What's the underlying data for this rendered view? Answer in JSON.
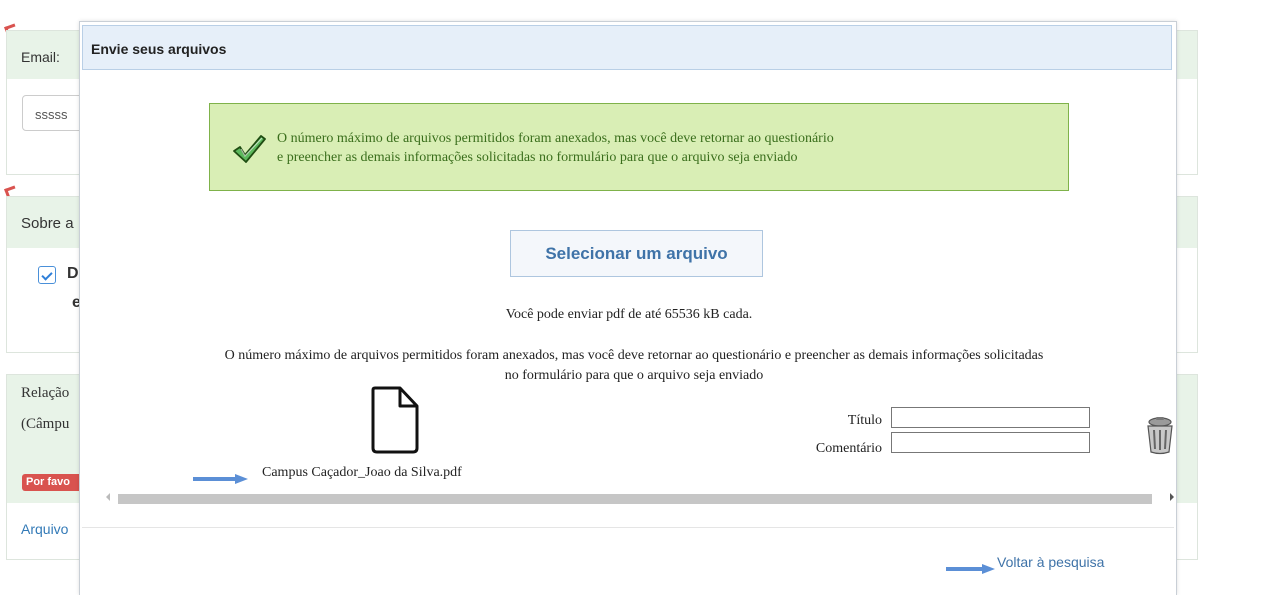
{
  "background": {
    "email_label": "Email:",
    "email_value": "sssss",
    "section2_label": "Sobre a",
    "checkbox_char_1": "D",
    "checkbox_char_2": "e",
    "section3_line1": "Relação",
    "section3_line2": "(Câmpu",
    "badge_text": "Por favo",
    "file_link": "Arquivo",
    "colors": {
      "required_mark": "#d9534f",
      "panel_header": "#e8f3e8",
      "badge": "#d9534f"
    }
  },
  "modal": {
    "title": "Envie seus arquivos",
    "success": {
      "icon": "checkmark-icon",
      "line1": "O número máximo de arquivos permitidos foram anexados, mas você deve retornar ao questionário",
      "line2": "e preencher as demais informações solicitadas no formulário para que o arquivo seja enviado",
      "colors": {
        "background": "#d9eeb5",
        "border": "#7fb24a",
        "text": "#3a6e1c"
      }
    },
    "select_button": "Selecionar um arquivo",
    "limit_text": "Você pode enviar pdf de até 65536 kB cada.",
    "warning_line1": "O número máximo de arquivos permitidos foram anexados, mas você deve retornar ao questionário e preencher as demais informações solicitadas",
    "warning_line2": "no formulário para que o arquivo seja enviado",
    "file": {
      "icon": "document-icon",
      "name": "Campus Caçador_Joao da Silva.pdf",
      "title_label": "Título",
      "title_value": "",
      "comment_label": "Comentário",
      "comment_value": "",
      "delete_icon": "trash-icon"
    },
    "back_link": "Voltar à pesquisa",
    "colors": {
      "title_bg": "#e6eff9",
      "link": "#3f73a8",
      "arrow": "#5b8fd6"
    }
  }
}
